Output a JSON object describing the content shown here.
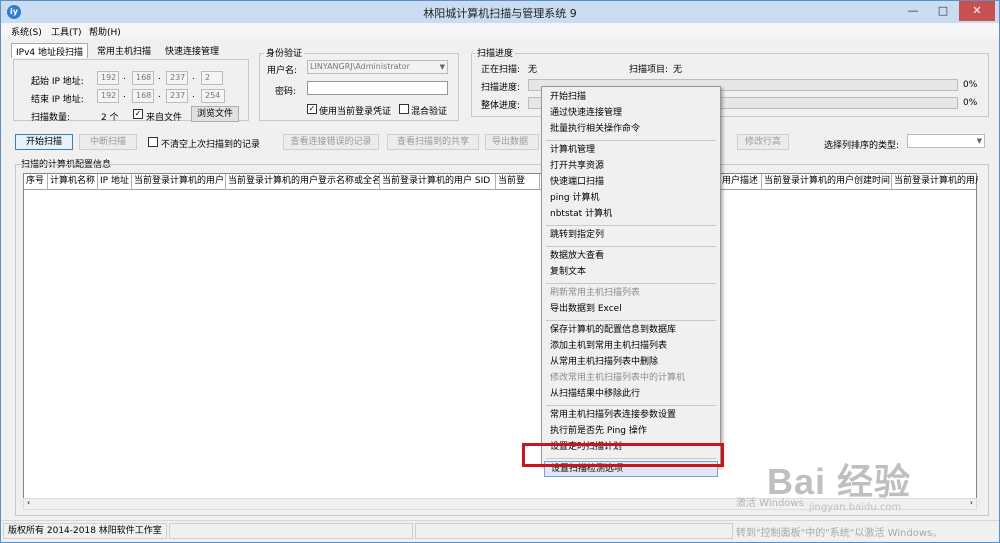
{
  "window": {
    "title": "林阳城计算机扫描与管理系统 9",
    "app_icon": "iy",
    "controls": [
      "—",
      "□",
      "✕"
    ]
  },
  "menu": [
    "系统(S)",
    "工具(T)",
    "帮助(H)"
  ],
  "tabs": [
    "IPv4 地址段扫描",
    "常用主机扫描",
    "快速连接管理"
  ],
  "ipv4": {
    "start_label": "起始 IP 地址:",
    "end_label": "结束 IP 地址:",
    "count_label": "扫描数量:",
    "start_ip": [
      "192",
      "168",
      "237",
      "2"
    ],
    "end_ip": [
      "192",
      "168",
      "237",
      "254"
    ],
    "count_value": "2 个",
    "from_file_label": "来自文件",
    "from_file_checked": true,
    "browse_label": "浏览文件"
  },
  "auth": {
    "title": "身份验证",
    "user_label": "用户名:",
    "user_value": "LINYANGRJ\\Administrator",
    "pwd_label": "密码:",
    "use_current_label": "使用当前登录凭证",
    "use_current_checked": true,
    "mixed_label": "混合验证",
    "mixed_checked": false
  },
  "progress": {
    "title": "扫描进度",
    "scanning_label": "正在扫描:",
    "scanning_value": "无",
    "item_label": "扫描项目:",
    "item_value": "无",
    "scan_prog_label": "扫描进度:",
    "scan_prog_value": "0%",
    "scan_prog_fraction": 0,
    "overall_label": "整体进度:",
    "overall_value": "0%",
    "overall_fraction": 0
  },
  "toolbar": {
    "start": "开始扫描",
    "stop": "中断扫描",
    "no_clear": "不清空上次扫描到的记录",
    "no_clear_checked": false,
    "view_errors": "查看连接错误的记录",
    "view_shares": "查看扫描到的共享",
    "export": "导出数据",
    "modify_row": "修改行高",
    "sort_label": "选择列排序的类型:"
  },
  "results": {
    "title": "扫描的计算机配置信息",
    "columns": [
      "序号",
      "计算机名称",
      "IP 地址",
      "当前登录计算机的用户",
      "当前登录计算机的用户登示名称或全名",
      "当前登录计算机的用户 SID",
      "当前登",
      "用户描述",
      "当前登录计算机的用户创建时间",
      "当前登录计算机的用户"
    ]
  },
  "context_menu": [
    {
      "label": "开始扫描",
      "disabled": false
    },
    {
      "label": "通过快速连接管理",
      "disabled": false
    },
    {
      "label": "批量执行相关操作命令",
      "disabled": false
    },
    {
      "sep": true
    },
    {
      "label": "计算机管理",
      "disabled": false
    },
    {
      "label": "打开共享资源",
      "disabled": false
    },
    {
      "label": "快速端口扫描",
      "disabled": false
    },
    {
      "label": "ping 计算机",
      "disabled": false
    },
    {
      "label": "nbtstat 计算机",
      "disabled": false
    },
    {
      "sep": true
    },
    {
      "label": "跳转到指定列",
      "disabled": false
    },
    {
      "sep": true
    },
    {
      "label": "数据放大查看",
      "disabled": false
    },
    {
      "label": "复制文本",
      "disabled": false
    },
    {
      "sep": true
    },
    {
      "label": "刷新常用主机扫描列表",
      "disabled": true
    },
    {
      "label": "导出数据到 Excel",
      "disabled": false
    },
    {
      "sep": true
    },
    {
      "label": "保存计算机的配置信息到数据库",
      "disabled": false
    },
    {
      "label": "添加主机到常用主机扫描列表",
      "disabled": false
    },
    {
      "label": "从常用主机扫描列表中删除",
      "disabled": false
    },
    {
      "label": "修改常用主机扫描列表中的计算机",
      "disabled": true
    },
    {
      "label": "从扫描结果中移除此行",
      "disabled": false
    },
    {
      "sep": true
    },
    {
      "label": "常用主机扫描列表连接参数设置",
      "disabled": false
    },
    {
      "label": "执行前是否先 Ping 操作",
      "disabled": false
    },
    {
      "label": "设置定时扫描计划",
      "disabled": false
    },
    {
      "sep": true
    },
    {
      "label": "设置扫描检测选项",
      "disabled": false,
      "highlighted": true
    }
  ],
  "status": {
    "copyright": "版权所有 2014-2018 林阳软件工作室"
  },
  "watermark": {
    "activate": "激活 Windows",
    "activate_hint": "转到\"控制面板\"中的\"系统\"以激活 Windows。",
    "baidu": "Bai 经验",
    "baidu_url": "jingyan.baidu.com"
  },
  "colors": {
    "highlight_border": "#c8161d",
    "titlebar": "#c9dcf1",
    "close_button": "#c75050"
  }
}
